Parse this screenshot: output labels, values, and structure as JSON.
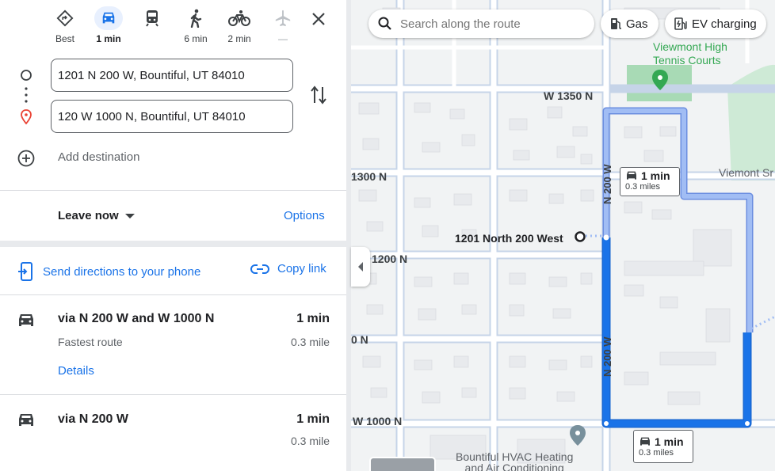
{
  "travel_modes": [
    {
      "name": "Best",
      "label": "Best",
      "icon": "diamond-route-icon"
    },
    {
      "name": "Driving",
      "label": "1 min",
      "icon": "car-icon",
      "active": true
    },
    {
      "name": "Transit",
      "label": "",
      "icon": "train-icon"
    },
    {
      "name": "Walking",
      "label": "6 min",
      "icon": "walk-icon"
    },
    {
      "name": "Cycling",
      "label": "2 min",
      "icon": "bike-icon"
    },
    {
      "name": "Flights",
      "label": "—",
      "icon": "plane-icon"
    }
  ],
  "waypoints": {
    "origin": "1201 N 200 W, Bountiful, UT 84010",
    "destination": "120 W 1000 N, Bountiful, UT 84010",
    "add_destination": "Add destination"
  },
  "departure": {
    "label": "Leave now",
    "options": "Options"
  },
  "share": {
    "send": "Send directions to your phone",
    "copy": "Copy link"
  },
  "routes": [
    {
      "name": "via N 200 W and W 1000 N",
      "time": "1 min",
      "subtitle": "Fastest route",
      "distance": "0.3 mile",
      "details": "Details"
    },
    {
      "name": "via N 200 W",
      "time": "1 min",
      "distance": "0.3 mile"
    }
  ],
  "map": {
    "search_placeholder": "Search along the route",
    "chips": [
      "Gas",
      "EV charging"
    ],
    "labels": {
      "tennis": "Viewmont High\nTennis Courts",
      "w1350": "W 1350 N",
      "n1300": "1300 N",
      "n1200": "1200 N",
      "n0": "0 N",
      "w1000": "W 1000 N",
      "viemont": "Viemont Sr",
      "start": "1201 North 200 West",
      "n200w_top": "N 200 W",
      "n200w_bottom": "N 200 W",
      "hvac": "Bountiful HVAC Heating\nand Air Conditioning"
    },
    "tooltip_alt": {
      "time": "1 min",
      "distance": "0.3 miles"
    },
    "tooltip_main": {
      "time": "1 min",
      "distance": "0.3 miles"
    }
  },
  "colors": {
    "route": "#1a73e8",
    "alt_route": "#a1bdf4",
    "accent": "#1a73e8"
  }
}
